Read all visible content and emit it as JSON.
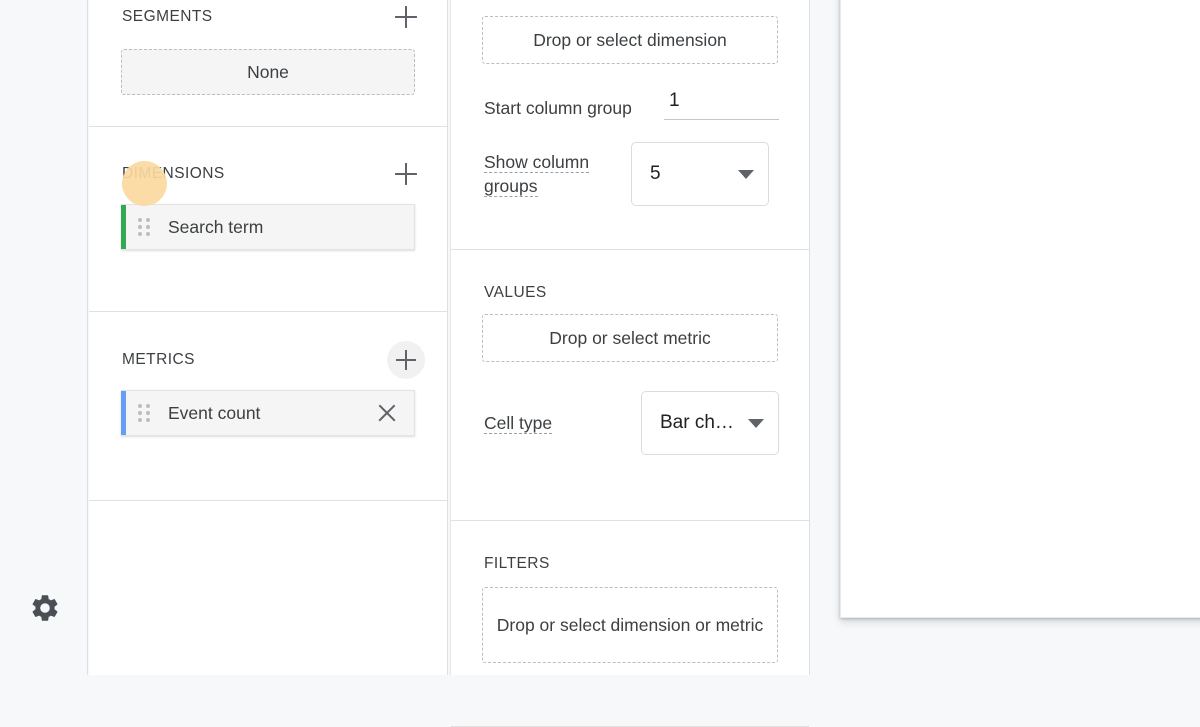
{
  "rail": {
    "settings_icon": "gear-icon"
  },
  "left_panel": {
    "segments": {
      "title": "SEGMENTS",
      "add_icon": "plus-icon",
      "dropzone_label": "None"
    },
    "dimensions": {
      "title": "DIMENSIONS",
      "add_icon": "plus-icon",
      "items": [
        {
          "label": "Search term",
          "accent": "#34a853",
          "drag_icon": "drag-handle-icon",
          "has_remove": false
        }
      ]
    },
    "metrics": {
      "title": "METRICS",
      "add_icon": "plus-icon",
      "items": [
        {
          "label": "Event count",
          "accent": "#669df6",
          "drag_icon": "drag-handle-icon",
          "has_remove": true,
          "remove_icon": "close-icon"
        }
      ]
    }
  },
  "mid_panel": {
    "columns": {
      "dropzone_label": "Drop or select dimension",
      "start_column_group": {
        "label": "Start column group",
        "value": "1"
      },
      "show_column_groups": {
        "label": "Show column groups",
        "value": "5",
        "caret_icon": "chevron-down-icon"
      }
    },
    "values": {
      "title": "VALUES",
      "dropzone_label": "Drop or select metric",
      "cell_type": {
        "label": "Cell type",
        "value": "Bar ch…",
        "caret_icon": "chevron-down-icon"
      }
    },
    "filters": {
      "title": "FILTERS",
      "dropzone_label": "Drop or select dimension or metric"
    }
  },
  "preview": {
    "name": "report-preview-card"
  },
  "colors": {
    "app_bg": "#f6f8fa",
    "panel_bg": "#ffffff",
    "text": "#3c4043",
    "divider": "#e0e0e0",
    "dimension_accent": "#34a853",
    "metric_accent": "#669df6",
    "cursor_highlight": "#fbd9a0"
  }
}
